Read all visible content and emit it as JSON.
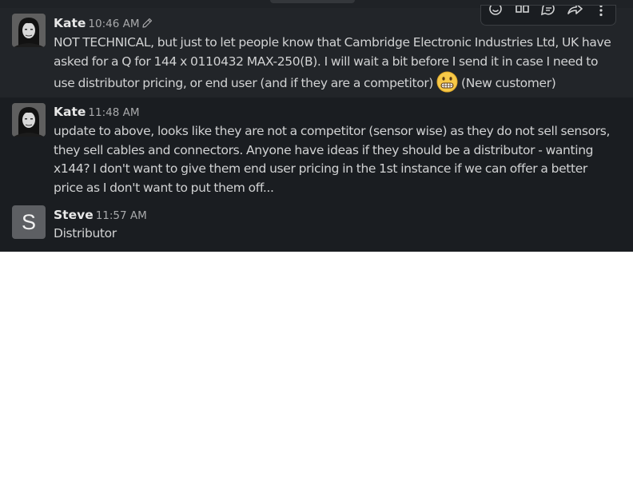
{
  "messages": [
    {
      "author": "Kate",
      "time": "10:46 AM",
      "edited_icon": "pencil-icon",
      "text_before": "NOT TECHNICAL, but just to let people know that Cambridge Electronic Industries Ltd, UK have asked for a Q for 144 x 0110432 MAX-250(B). I will wait a bit before I send it in case I need to use distributor pricing, or end user (and if they are a competitor)",
      "emoji": "grimacing-face-emoji",
      "text_after": "(New customer)"
    },
    {
      "author": "Kate",
      "time": "11:48 AM",
      "text": "update to above, looks like they are not a competitor (sensor wise) as they do not sell sensors, they sell cables and connectors. Anyone have ideas if they should be a distributor - wanting x144? I don't want to give them end user pricing in the 1st instance if we can offer a better price as I don't want to put them off..."
    },
    {
      "author": "Steve",
      "avatar_letter": "S",
      "time": "11:57 AM",
      "text": "Distributor"
    }
  ],
  "hover_actions": [
    "add-reaction-icon",
    "quick-actions-icon",
    "reply-in-thread-icon",
    "forward-message-icon",
    "more-actions-icon"
  ],
  "colors": {
    "background": "#1a1d21",
    "hover_background": "#222529",
    "text": "#d1d2d3",
    "author": "#e8e8e8",
    "timestamp": "#a8a9ab",
    "avatar_letter_bg": "#5d5f63"
  }
}
